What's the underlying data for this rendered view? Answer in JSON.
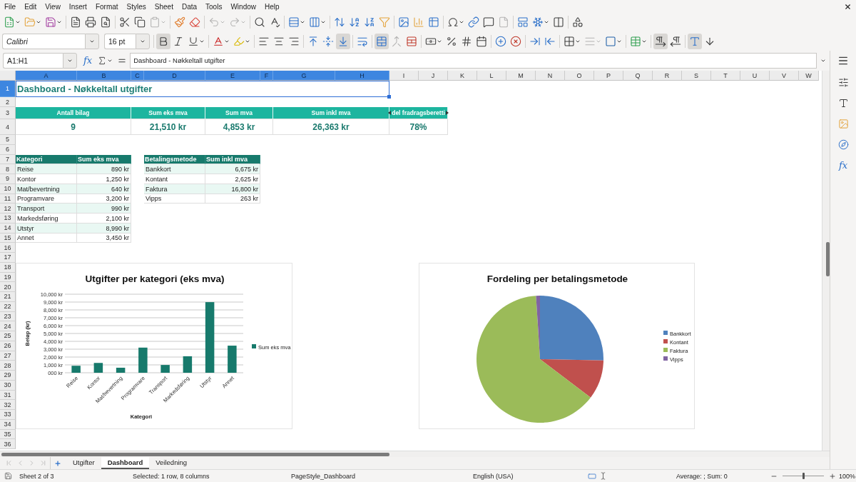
{
  "menu_bar": [
    "File",
    "Edit",
    "View",
    "Insert",
    "Format",
    "Styles",
    "Sheet",
    "Data",
    "Tools",
    "Window",
    "Help"
  ],
  "standard_toolbar": [
    {
      "buttons": [
        {
          "kind": "new",
          "menu": true,
          "disabled": false
        },
        {
          "kind": "open",
          "menu": true,
          "disabled": false
        },
        {
          "kind": "save",
          "menu": true,
          "disabled": false
        }
      ]
    },
    {
      "buttons": [
        {
          "kind": "export_pdf",
          "menu": false,
          "disabled": false
        },
        {
          "kind": "print",
          "menu": false,
          "disabled": false
        },
        {
          "kind": "preview",
          "menu": false,
          "disabled": false
        }
      ]
    },
    {
      "buttons": [
        {
          "kind": "cut",
          "menu": false,
          "disabled": false
        },
        {
          "kind": "copy",
          "menu": false,
          "disabled": false
        },
        {
          "kind": "paste",
          "menu": true,
          "disabled": true
        }
      ]
    },
    {
      "buttons": [
        {
          "kind": "clone",
          "menu": false,
          "disabled": false
        },
        {
          "kind": "clear",
          "menu": false,
          "disabled": false
        }
      ]
    },
    {
      "buttons": [
        {
          "kind": "undo",
          "menu": true,
          "disabled": true
        },
        {
          "kind": "redo",
          "menu": true,
          "disabled": true
        }
      ]
    },
    {
      "buttons": [
        {
          "kind": "find",
          "menu": false,
          "disabled": false
        },
        {
          "kind": "spelling",
          "menu": false,
          "disabled": false
        }
      ]
    },
    {
      "buttons": [
        {
          "kind": "row",
          "menu": true,
          "disabled": false
        },
        {
          "kind": "column",
          "menu": true,
          "disabled": false
        }
      ]
    },
    {
      "buttons": [
        {
          "kind": "sort",
          "menu": false,
          "disabled": false
        },
        {
          "kind": "sort_asc",
          "menu": false,
          "disabled": false
        },
        {
          "kind": "sort_desc",
          "menu": false,
          "disabled": false
        },
        {
          "kind": "autofilter",
          "menu": false,
          "disabled": false
        }
      ]
    },
    {
      "buttons": [
        {
          "kind": "image",
          "menu": false,
          "disabled": false
        },
        {
          "kind": "chart",
          "menu": false,
          "disabled": false
        },
        {
          "kind": "pivot",
          "menu": false,
          "disabled": false
        }
      ]
    },
    {
      "buttons": [
        {
          "kind": "special_char",
          "menu": true,
          "disabled": false
        },
        {
          "kind": "hyperlink",
          "menu": false,
          "disabled": false
        },
        {
          "kind": "comment",
          "menu": false,
          "disabled": false
        },
        {
          "kind": "header_footer",
          "menu": false,
          "disabled": true
        }
      ]
    },
    {
      "buttons": [
        {
          "kind": "print_area",
          "menu": false,
          "disabled": false
        },
        {
          "kind": "freeze",
          "menu": true,
          "disabled": false
        },
        {
          "kind": "split",
          "menu": false,
          "disabled": false
        }
      ]
    },
    {
      "buttons": [
        {
          "kind": "draw",
          "menu": false,
          "disabled": false
        }
      ]
    }
  ],
  "format_toolbar": {
    "font_name": "Calibri",
    "font_size": "16 pt",
    "groups": [
      {
        "buttons": [
          {
            "kind": "bold",
            "pressed": true,
            "disabled": false,
            "menu": false
          },
          {
            "kind": "italic",
            "pressed": false,
            "disabled": false,
            "menu": false
          },
          {
            "kind": "underline",
            "pressed": false,
            "disabled": false,
            "menu": true
          }
        ]
      },
      {
        "buttons": [
          {
            "kind": "font_color",
            "pressed": false,
            "disabled": false,
            "menu": true
          },
          {
            "kind": "highlight",
            "pressed": false,
            "disabled": false,
            "menu": true
          }
        ]
      },
      {
        "buttons": [
          {
            "kind": "align_left",
            "pressed": false,
            "disabled": false,
            "menu": false
          },
          {
            "kind": "align_center",
            "pressed": false,
            "disabled": false,
            "menu": false
          },
          {
            "kind": "align_right",
            "pressed": false,
            "disabled": false,
            "menu": false
          }
        ]
      },
      {
        "buttons": [
          {
            "kind": "align_top",
            "pressed": false,
            "disabled": false,
            "menu": false
          },
          {
            "kind": "align_middle",
            "pressed": false,
            "disabled": false,
            "menu": false
          },
          {
            "kind": "align_bottom",
            "pressed": true,
            "disabled": false,
            "menu": false
          }
        ]
      },
      {
        "buttons": [
          {
            "kind": "wrap",
            "pressed": false,
            "disabled": false,
            "menu": false
          }
        ]
      },
      {
        "buttons": [
          {
            "kind": "merge_center",
            "pressed": true,
            "disabled": false,
            "menu": false
          },
          {
            "kind": "merge_cells",
            "pressed": false,
            "disabled": true,
            "menu": false
          },
          {
            "kind": "unmerge",
            "pressed": false,
            "disabled": false,
            "menu": false
          }
        ]
      },
      {
        "buttons": [
          {
            "kind": "currency",
            "pressed": false,
            "disabled": false,
            "menu": true
          },
          {
            "kind": "percent",
            "pressed": false,
            "disabled": false,
            "menu": false
          },
          {
            "kind": "number",
            "pressed": false,
            "disabled": false,
            "menu": false
          },
          {
            "kind": "date",
            "pressed": false,
            "disabled": false,
            "menu": false
          }
        ]
      },
      {
        "buttons": [
          {
            "kind": "add_decimal",
            "pressed": false,
            "disabled": false,
            "menu": false
          },
          {
            "kind": "delete_decimal",
            "pressed": false,
            "disabled": false,
            "menu": false
          }
        ]
      },
      {
        "buttons": [
          {
            "kind": "indent_increase",
            "pressed": false,
            "disabled": false,
            "menu": false
          },
          {
            "kind": "indent_decrease",
            "pressed": false,
            "disabled": false,
            "menu": false
          }
        ]
      },
      {
        "buttons": [
          {
            "kind": "borders",
            "pressed": false,
            "disabled": false,
            "menu": true
          },
          {
            "kind": "border_style",
            "pressed": false,
            "disabled": true,
            "menu": true
          },
          {
            "kind": "border_color",
            "pressed": false,
            "disabled": false,
            "menu": true
          }
        ]
      },
      {
        "buttons": [
          {
            "kind": "conditional",
            "pressed": false,
            "disabled": false,
            "menu": true
          }
        ]
      },
      {
        "buttons": [
          {
            "kind": "ltr",
            "pressed": true,
            "disabled": false,
            "menu": false
          },
          {
            "kind": "rtl",
            "pressed": false,
            "disabled": false,
            "menu": false
          }
        ]
      },
      {
        "buttons": [
          {
            "kind": "text_ltr",
            "pressed": true,
            "disabled": false,
            "menu": false
          },
          {
            "kind": "text_ttb",
            "pressed": false,
            "disabled": false,
            "menu": false
          }
        ]
      }
    ]
  },
  "formula_bar": {
    "name_box": "A1:H1",
    "function_glyph": "fx",
    "content": "Dashboard - Nøkkeltall utgifter"
  },
  "sheet": {
    "column_headers": [
      {
        "label": "A",
        "selected": true
      },
      {
        "label": "B",
        "selected": true
      },
      {
        "label": "C",
        "selected": true
      },
      {
        "label": "D",
        "selected": true
      },
      {
        "label": "E",
        "selected": true
      },
      {
        "label": "F",
        "selected": true
      },
      {
        "label": "G",
        "selected": true
      },
      {
        "label": "H",
        "selected": true
      },
      {
        "label": "I",
        "selected": false
      },
      {
        "label": "J",
        "selected": false
      },
      {
        "label": "K",
        "selected": false
      },
      {
        "label": "L",
        "selected": false
      },
      {
        "label": "M",
        "selected": false
      },
      {
        "label": "N",
        "selected": false
      },
      {
        "label": "O",
        "selected": false
      },
      {
        "label": "P",
        "selected": false
      },
      {
        "label": "Q",
        "selected": false
      },
      {
        "label": "R",
        "selected": false
      },
      {
        "label": "S",
        "selected": false
      },
      {
        "label": "T",
        "selected": false
      },
      {
        "label": "U",
        "selected": false
      },
      {
        "label": "V",
        "selected": false
      },
      {
        "label": "W",
        "selected": false
      }
    ],
    "row_headers": [
      {
        "label": "1",
        "selected": true
      },
      {
        "label": "2",
        "selected": false
      },
      {
        "label": "3",
        "selected": false
      },
      {
        "label": "4",
        "selected": false
      },
      {
        "label": "5",
        "selected": false
      },
      {
        "label": "6",
        "selected": false
      },
      {
        "label": "7",
        "selected": false
      },
      {
        "label": "8",
        "selected": false
      },
      {
        "label": "9",
        "selected": false
      },
      {
        "label": "10",
        "selected": false
      },
      {
        "label": "11",
        "selected": false
      },
      {
        "label": "12",
        "selected": false
      },
      {
        "label": "13",
        "selected": false
      },
      {
        "label": "14",
        "selected": false
      },
      {
        "label": "15",
        "selected": false
      },
      {
        "label": "16",
        "selected": false
      },
      {
        "label": "17",
        "selected": false
      },
      {
        "label": "18",
        "selected": false
      },
      {
        "label": "19",
        "selected": false
      },
      {
        "label": "20",
        "selected": false
      },
      {
        "label": "21",
        "selected": false
      },
      {
        "label": "22",
        "selected": false
      },
      {
        "label": "23",
        "selected": false
      },
      {
        "label": "24",
        "selected": false
      },
      {
        "label": "25",
        "selected": false
      },
      {
        "label": "26",
        "selected": false
      },
      {
        "label": "27",
        "selected": false
      },
      {
        "label": "28",
        "selected": false
      },
      {
        "label": "29",
        "selected": false
      },
      {
        "label": "30",
        "selected": false
      },
      {
        "label": "31",
        "selected": false
      },
      {
        "label": "32",
        "selected": false
      },
      {
        "label": "33",
        "selected": false
      },
      {
        "label": "34",
        "selected": false
      },
      {
        "label": "35",
        "selected": false
      },
      {
        "label": "36",
        "selected": false
      }
    ],
    "title": "Dashboard - Nøkkeltall utgifter",
    "kpis": [
      {
        "label": "Antall bilag",
        "value": "9",
        "clipped": false
      },
      {
        "label": "Sum eks mva",
        "value": "21,510 kr",
        "clipped": false
      },
      {
        "label": "Sum mva",
        "value": "4,853 kr",
        "clipped": false
      },
      {
        "label": "Sum inkl mva",
        "value": "26,363 kr",
        "clipped": false
      },
      {
        "label": "del fradragsberetti",
        "value": "78%",
        "clipped": true
      }
    ],
    "category_table": {
      "columns": [
        "Kategori",
        "Sum eks mva"
      ],
      "rows": [
        [
          "Reise",
          "890 kr"
        ],
        [
          "Kontor",
          "1,250 kr"
        ],
        [
          "Mat/bevertning",
          "640 kr"
        ],
        [
          "Programvare",
          "3,200 kr"
        ],
        [
          "Transport",
          "990 kr"
        ],
        [
          "Markedsføring",
          "2,100 kr"
        ],
        [
          "Utstyr",
          "8,990 kr"
        ],
        [
          "Annet",
          "3,450 kr"
        ]
      ]
    },
    "payment_table": {
      "columns": [
        "Betalingsmetode",
        "Sum inkl mva"
      ],
      "rows": [
        [
          "Bankkort",
          "6,675 kr"
        ],
        [
          "Kontant",
          "2,625 kr"
        ],
        [
          "Faktura",
          "16,800 kr"
        ],
        [
          "Vipps",
          "263 kr"
        ]
      ]
    }
  },
  "charts": [
    {
      "chart_data": {
        "type": "bar",
        "title": "Utgifter per kategori (eks mva)",
        "xlabel": "Kategori",
        "ylabel": "Beløp (kr)",
        "categories": [
          "Reise",
          "Kontor",
          "Mat/bevertning",
          "Programvare",
          "Transport",
          "Markedsføring",
          "Utstyr",
          "Annet"
        ],
        "series": [
          {
            "name": "Sum eks mva",
            "color": "#177a6c",
            "values": [
              890,
              1250,
              640,
              3200,
              990,
              2100,
              8990,
              3450
            ]
          }
        ],
        "ylim": [
          0,
          10000
        ],
        "yticks": [
          {
            "value": 0,
            "label": "000 kr"
          },
          {
            "value": 1000,
            "label": "1,000 kr"
          },
          {
            "value": 2000,
            "label": "2,000 kr"
          },
          {
            "value": 3000,
            "label": "3,000 kr"
          },
          {
            "value": 4000,
            "label": "4,000 kr"
          },
          {
            "value": 5000,
            "label": "5,000 kr"
          },
          {
            "value": 6000,
            "label": "6,000 kr"
          },
          {
            "value": 7000,
            "label": "7,000 kr"
          },
          {
            "value": 8000,
            "label": "8,000 kr"
          },
          {
            "value": 9000,
            "label": "9,000 kr"
          },
          {
            "value": 10000,
            "label": "10,000 kr"
          }
        ],
        "grid": true,
        "legend": "right"
      }
    },
    {
      "chart_data": {
        "type": "pie",
        "title": "Fordeling per betalingsmetode",
        "categories": [
          "Bankkort",
          "Kontant",
          "Faktura",
          "Vipps"
        ],
        "values": [
          25.3,
          10.0,
          63.7,
          1.0
        ],
        "colors": [
          "#4f81bd",
          "#c0504d",
          "#9bbb59",
          "#8064a2"
        ],
        "legend": "right"
      }
    }
  ],
  "sheet_tabs": {
    "navigation": [
      {
        "kind": "first",
        "disabled": true
      },
      {
        "kind": "previous",
        "disabled": true
      },
      {
        "kind": "next",
        "disabled": true
      },
      {
        "kind": "last",
        "disabled": true
      }
    ],
    "tabs": [
      {
        "label": "Utgifter",
        "selected": false
      },
      {
        "label": "Dashboard",
        "selected": true
      },
      {
        "label": "Veiledning",
        "selected": false
      }
    ]
  },
  "sidebar": {
    "function_glyph": "fx"
  },
  "status_bar": {
    "sheet": "Sheet 2 of 3",
    "selection": "Selected: 1 row, 8 columns",
    "page_style": "PageStyle_Dashboard",
    "language": "English (USA)",
    "summary": "Average: ; Sum: 0",
    "zoom": {
      "level": 0.5,
      "reading": "100%"
    }
  }
}
